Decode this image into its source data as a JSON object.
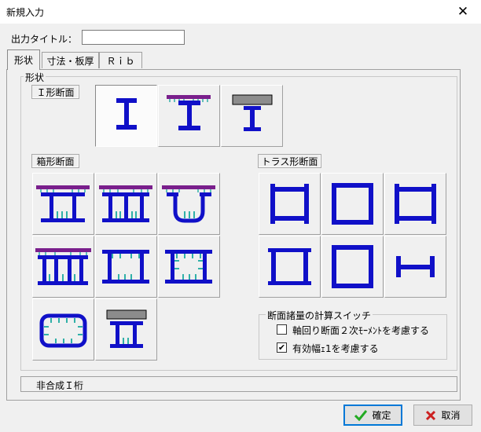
{
  "window": {
    "title": "新規入力",
    "close_glyph": "✕"
  },
  "output_title": {
    "label": "出力タイトル：",
    "value": ""
  },
  "tabs": [
    {
      "label": "形状",
      "active": true
    },
    {
      "label": "寸法・板厚",
      "active": false
    },
    {
      "label": "Ｒｉｂ",
      "active": false
    }
  ],
  "shape_group": {
    "legend": "形状"
  },
  "i_section": {
    "label": "Ｉ形断面",
    "selected_index": 0
  },
  "box_section": {
    "label": "箱形断面"
  },
  "truss_section": {
    "label": "トラス形断面"
  },
  "calc_switch": {
    "legend": "断面諸量の計算スイッチ",
    "options": [
      {
        "label": "軸回り断面２次ﾓｰﾒﾝﾄを考慮する",
        "checked": false
      },
      {
        "label": "有効幅ｪ1を考慮する",
        "checked": true
      }
    ],
    "check_glyph": "✔"
  },
  "status": {
    "text": "非合成Ｉ桁"
  },
  "buttons": {
    "ok": {
      "label": "確定",
      "icon": "checkmark-icon",
      "icon_color": "#22aa22"
    },
    "cancel": {
      "label": "取消",
      "icon": "x-mark-icon",
      "icon_color": "#cc2020"
    }
  },
  "colors": {
    "steel": "#1010c8",
    "slab_purple": "#7a1f8c",
    "slab_concrete": "#8c8c8c",
    "stiffener": "#30b0a8"
  }
}
